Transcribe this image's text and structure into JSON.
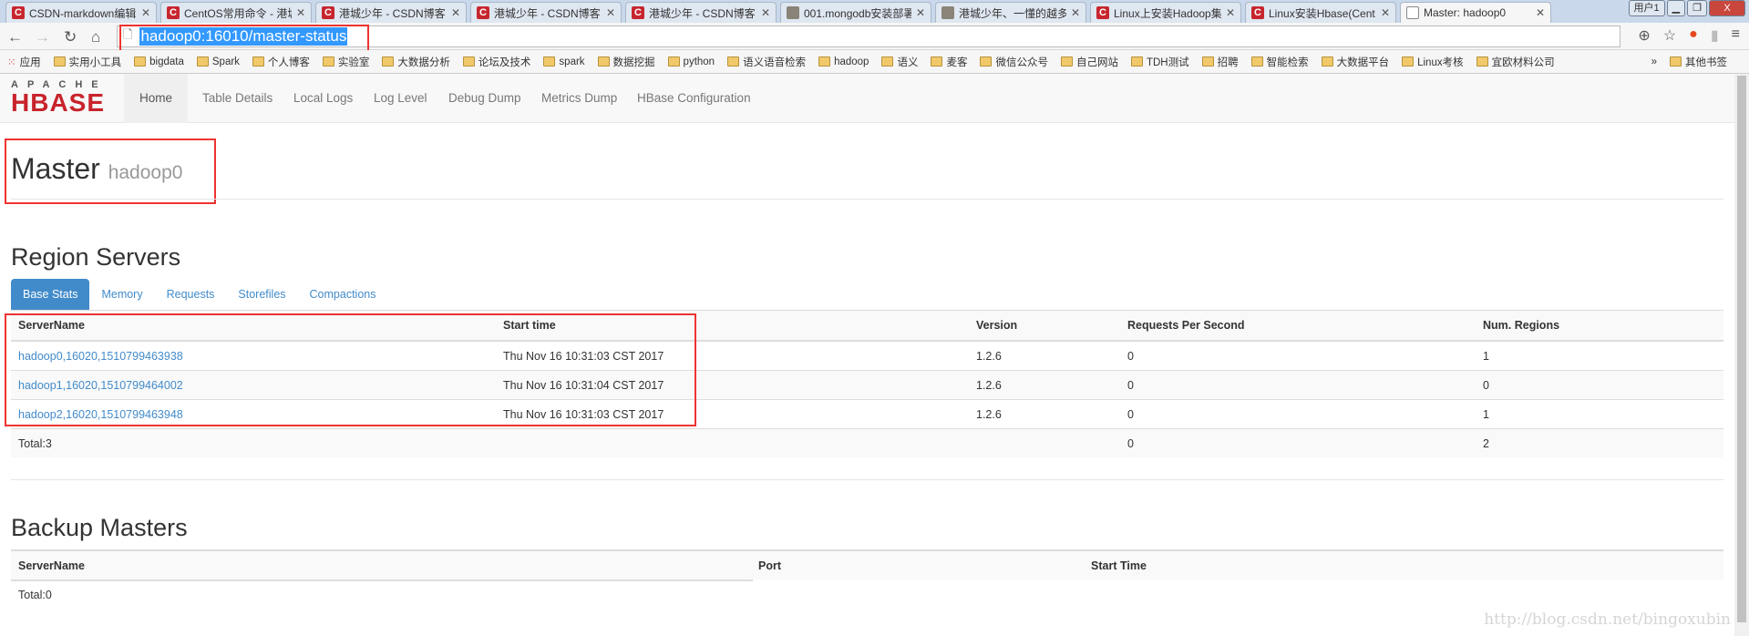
{
  "browser": {
    "tabs": [
      {
        "title": "CSDN-markdown编辑",
        "icon": "csdn-icon"
      },
      {
        "title": "CentOS常用命令 - 港城",
        "icon": "csdn-icon"
      },
      {
        "title": "港城少年 - CSDN博客",
        "icon": "csdn-icon"
      },
      {
        "title": "港城少年 - CSDN博客",
        "icon": "csdn-icon"
      },
      {
        "title": "港城少年 - CSDN博客",
        "icon": "csdn-icon"
      },
      {
        "title": "001.mongodb安装部署",
        "icon": "avatar-icon"
      },
      {
        "title": "港城少年、一懂的越多",
        "icon": "avatar-icon"
      },
      {
        "title": "Linux上安装Hadoop集",
        "icon": "csdn-icon"
      },
      {
        "title": "Linux安装Hbase(Cent",
        "icon": "csdn-icon"
      },
      {
        "title": "Master: hadoop0",
        "icon": "page-icon",
        "active": true
      }
    ],
    "user_label": "用户1",
    "url": "hadoop0:16010/master-status",
    "bookmarks": [
      "应用",
      "实用小工具",
      "bigdata",
      "Spark",
      "个人博客",
      "实验室",
      "大数据分析",
      "论坛及技术",
      "spark",
      "数据挖掘",
      "python",
      "语义语音检索",
      "hadoop",
      "语义",
      "麦客",
      "微信公众号",
      "自己网站",
      "TDH测试",
      "招聘",
      "智能检索",
      "大数据平台",
      "Linux考核",
      "宜欧材料公司"
    ],
    "bookmarks_more": "»",
    "other_bookmarks": "其他书签"
  },
  "logo": {
    "top": "APACHE",
    "main": "HBASE",
    "color": "#c8232c"
  },
  "nav": [
    "Home",
    "Table Details",
    "Local Logs",
    "Log Level",
    "Debug Dump",
    "Metrics Dump",
    "HBase Configuration"
  ],
  "master": {
    "title": "Master",
    "host": "hadoop0"
  },
  "region_servers": {
    "title": "Region Servers",
    "tabs": [
      "Base Stats",
      "Memory",
      "Requests",
      "Storefiles",
      "Compactions"
    ],
    "active_tab": "Base Stats",
    "columns": [
      "ServerName",
      "Start time",
      "Version",
      "Requests Per Second",
      "Num. Regions"
    ],
    "rows": [
      [
        "hadoop0,16020,1510799463938",
        "Thu Nov 16 10:31:03 CST 2017",
        "1.2.6",
        "0",
        "1"
      ],
      [
        "hadoop1,16020,1510799464002",
        "Thu Nov 16 10:31:04 CST 2017",
        "1.2.6",
        "0",
        "0"
      ],
      [
        "hadoop2,16020,1510799463948",
        "Thu Nov 16 10:31:03 CST 2017",
        "1.2.6",
        "0",
        "1"
      ]
    ],
    "total": [
      "Total:3",
      "",
      "",
      "0",
      "2"
    ]
  },
  "backup_masters": {
    "title": "Backup Masters",
    "columns": [
      "ServerName",
      "Port",
      "Start Time"
    ],
    "total": "Total:0"
  },
  "watermark": "http://blog.csdn.net/bingoxubin",
  "colors": {
    "accent": "#428bca",
    "highlight": "#ee3333"
  }
}
